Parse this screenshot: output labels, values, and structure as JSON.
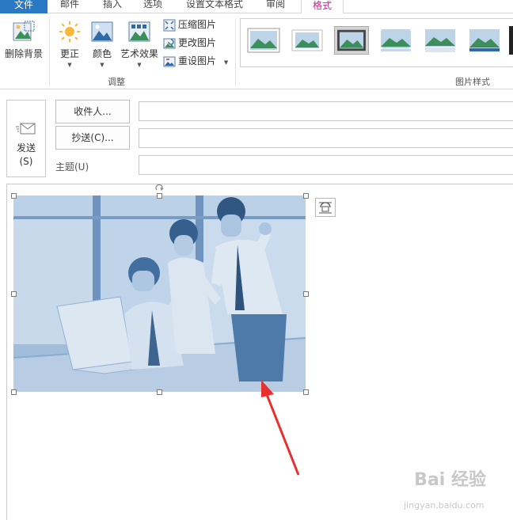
{
  "ribbon": {
    "tabs": [
      "文件",
      "邮件",
      "插入",
      "选项",
      "设置文本格式",
      "审阅",
      "格式"
    ],
    "buttons": {
      "remove_bg": "删除背景",
      "corrections": "更正",
      "color": "颜色",
      "artistic": "艺术效果",
      "compress": "压缩图片",
      "change": "更改图片",
      "reset": "重设图片"
    },
    "groups": {
      "adjust": "调整",
      "styles": "图片样式"
    }
  },
  "compose": {
    "send": "发送",
    "send_key": "(S)",
    "to": "收件人...",
    "cc": "抄送(C)...",
    "subject": "主题(U)"
  },
  "watermark": {
    "logo": "Bai 经验",
    "url": "jingyan.baidu.com"
  },
  "colors": {
    "accent": "#c0288d",
    "file_tab": "#2b78c5",
    "photo_tint": "#6f9cc9",
    "arrow": "#e8312f"
  }
}
